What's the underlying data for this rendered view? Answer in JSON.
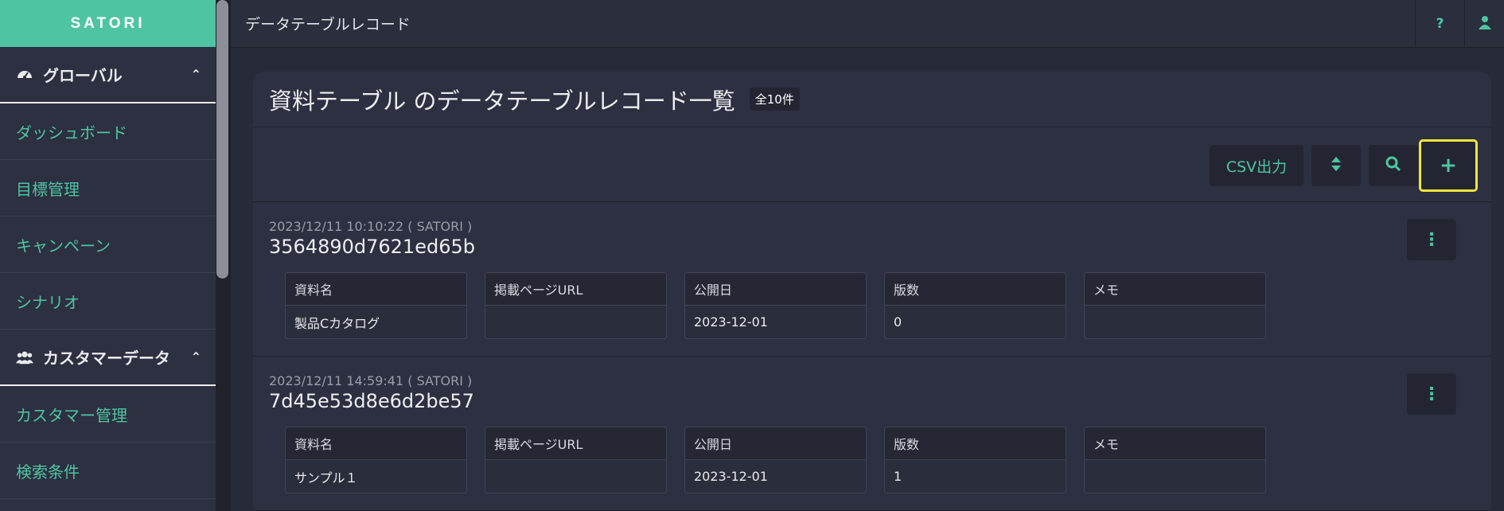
{
  "app": {
    "brand": "SATORI"
  },
  "sidebar": {
    "sections": [
      {
        "label": "グローバル",
        "icon": "dashboard-icon",
        "items": [
          "ダッシュボード",
          "目標管理",
          "キャンペーン",
          "シナリオ"
        ]
      },
      {
        "label": "カスタマーデータ",
        "icon": "users-icon",
        "items": [
          "カスタマー管理",
          "検索条件"
        ]
      }
    ]
  },
  "topbar": {
    "title": "データテーブルレコード",
    "help_label": "?",
    "user_icon": "user-icon"
  },
  "panel": {
    "title": "資料テーブル のデータテーブルレコード一覧",
    "count": "全10件",
    "toolbar": {
      "csv_label": "CSV出力",
      "sort_icon": "sort-icon",
      "search_icon": "search-icon",
      "add_label": "+"
    }
  },
  "columns": [
    "資料名",
    "掲載ページURL",
    "公開日",
    "版数",
    "メモ"
  ],
  "records": [
    {
      "meta": "2023/12/11 10:10:22 ( SATORI )",
      "id": "3564890d7621ed65b",
      "values": [
        "製品Cカタログ",
        "",
        "2023-12-01",
        "0",
        ""
      ]
    },
    {
      "meta": "2023/12/11 14:59:41 ( SATORI )",
      "id": "7d45e53d8e6d2be57",
      "values": [
        "サンプル１",
        "",
        "2023-12-01",
        "1",
        ""
      ]
    }
  ],
  "colors": {
    "accent": "#4fc4a3",
    "highlight": "#f0e63c",
    "background": "#272a38",
    "panel": "#2c3040"
  }
}
